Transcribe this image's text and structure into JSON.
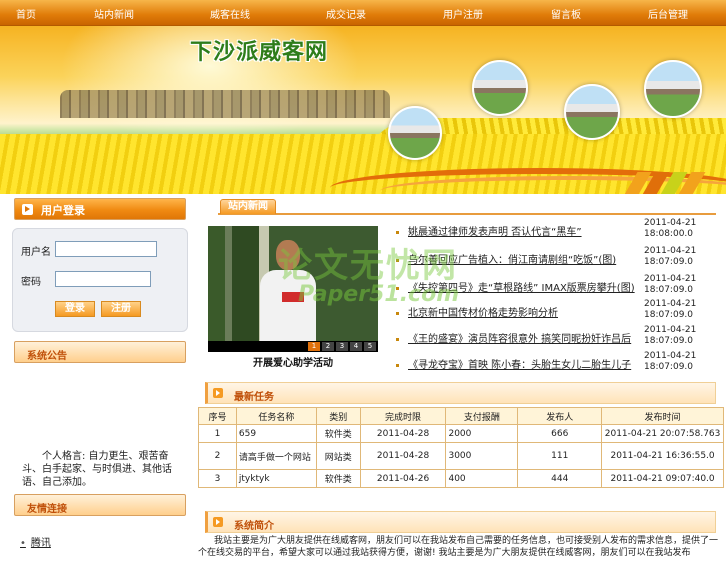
{
  "nav": [
    {
      "label": "首页",
      "name": "nav-home"
    },
    {
      "label": "站内新闻",
      "name": "nav-news"
    },
    {
      "label": "威客在线",
      "name": "nav-witkey-online"
    },
    {
      "label": "成交记录",
      "name": "nav-deal-records"
    },
    {
      "label": "用户注册",
      "name": "nav-register"
    },
    {
      "label": "留言板",
      "name": "nav-message-board"
    },
    {
      "label": "后台管理",
      "name": "nav-admin"
    }
  ],
  "banner": {
    "title": "下沙派威客网"
  },
  "login": {
    "title": "用户登录",
    "username_label": "用户名",
    "password_label": "密码",
    "login_button": "登录",
    "register_button": "注册"
  },
  "announcement": {
    "title": "系统公告",
    "motto": "个人格言: 自力更生、艰苦奋斗、白手起家、与时俱进、其他话语、自己添加。"
  },
  "links": {
    "title": "友情连接",
    "items": [
      "腾讯"
    ]
  },
  "news": {
    "tab": "站内新闻",
    "photo_caption": "开展爱心助学活动",
    "slide_numbers": [
      "1",
      "2",
      "3",
      "4",
      "5"
    ],
    "items": [
      {
        "title": "姚晨通过律师发表声明 否认代言“黑车”",
        "date": "2011-04-21",
        "time": "18:08:00.0"
      },
      {
        "title": "乌尔善回应广告植入：俏江南请剧组“吃饭”(图)",
        "date": "2011-04-21",
        "time": "18:07:09.0"
      },
      {
        "title": "《失控第四号》走“草根路线” IMAX版票房攀升(图)",
        "date": "2011-04-21",
        "time": "18:07:09.0"
      },
      {
        "title": "北京新中国传材价格走势影响分析",
        "date": "2011-04-21",
        "time": "18:07:09.0"
      },
      {
        "title": "《王的盛宴》演员阵容很意外 搞笑同昵扮奸诈吕后",
        "date": "2011-04-21",
        "time": "18:07:09.0"
      },
      {
        "title": "《寻龙夺宝》首映 陈小春：头胎生女儿二胎生儿子",
        "date": "2011-04-21",
        "time": "18:07:09.0"
      }
    ]
  },
  "watermark": {
    "line1": "论文无忧网",
    "line2": "Paper51.com"
  },
  "tasks": {
    "title": "最新任务",
    "columns": [
      "序号",
      "任务名称",
      "类别",
      "完成时限",
      "支付报酬",
      "发布人",
      "发布时间"
    ],
    "rows": [
      [
        "1",
        "659",
        "软件类",
        "2011-04-28",
        "2000",
        "666",
        "2011-04-21 20:07:58.763"
      ],
      [
        "2",
        "请高手做一个网站",
        "网站类",
        "2011-04-28",
        "3000",
        "111",
        "2011-04-21 16:36:55.0"
      ],
      [
        "3",
        "jtyktyk",
        "软件类",
        "2011-04-26",
        "400",
        "444",
        "2011-04-21 09:07:40.0"
      ]
    ]
  },
  "intro": {
    "title": "系统简介",
    "text": "我站主要是为广大朋友提供在线威客网，朋友们可以在我站发布自己需要的任务信息，也可接受别人发布的需求信息，提供了一个在线交易的平台，希望大家可以通过我站获得方便，谢谢!     我站主要是为广大朋友提供在线威客网，朋友们可以在我站发布"
  },
  "colors": {
    "accent": "#e07b08",
    "header_text": "#c0500a",
    "title_green": "#2e7d1a"
  }
}
